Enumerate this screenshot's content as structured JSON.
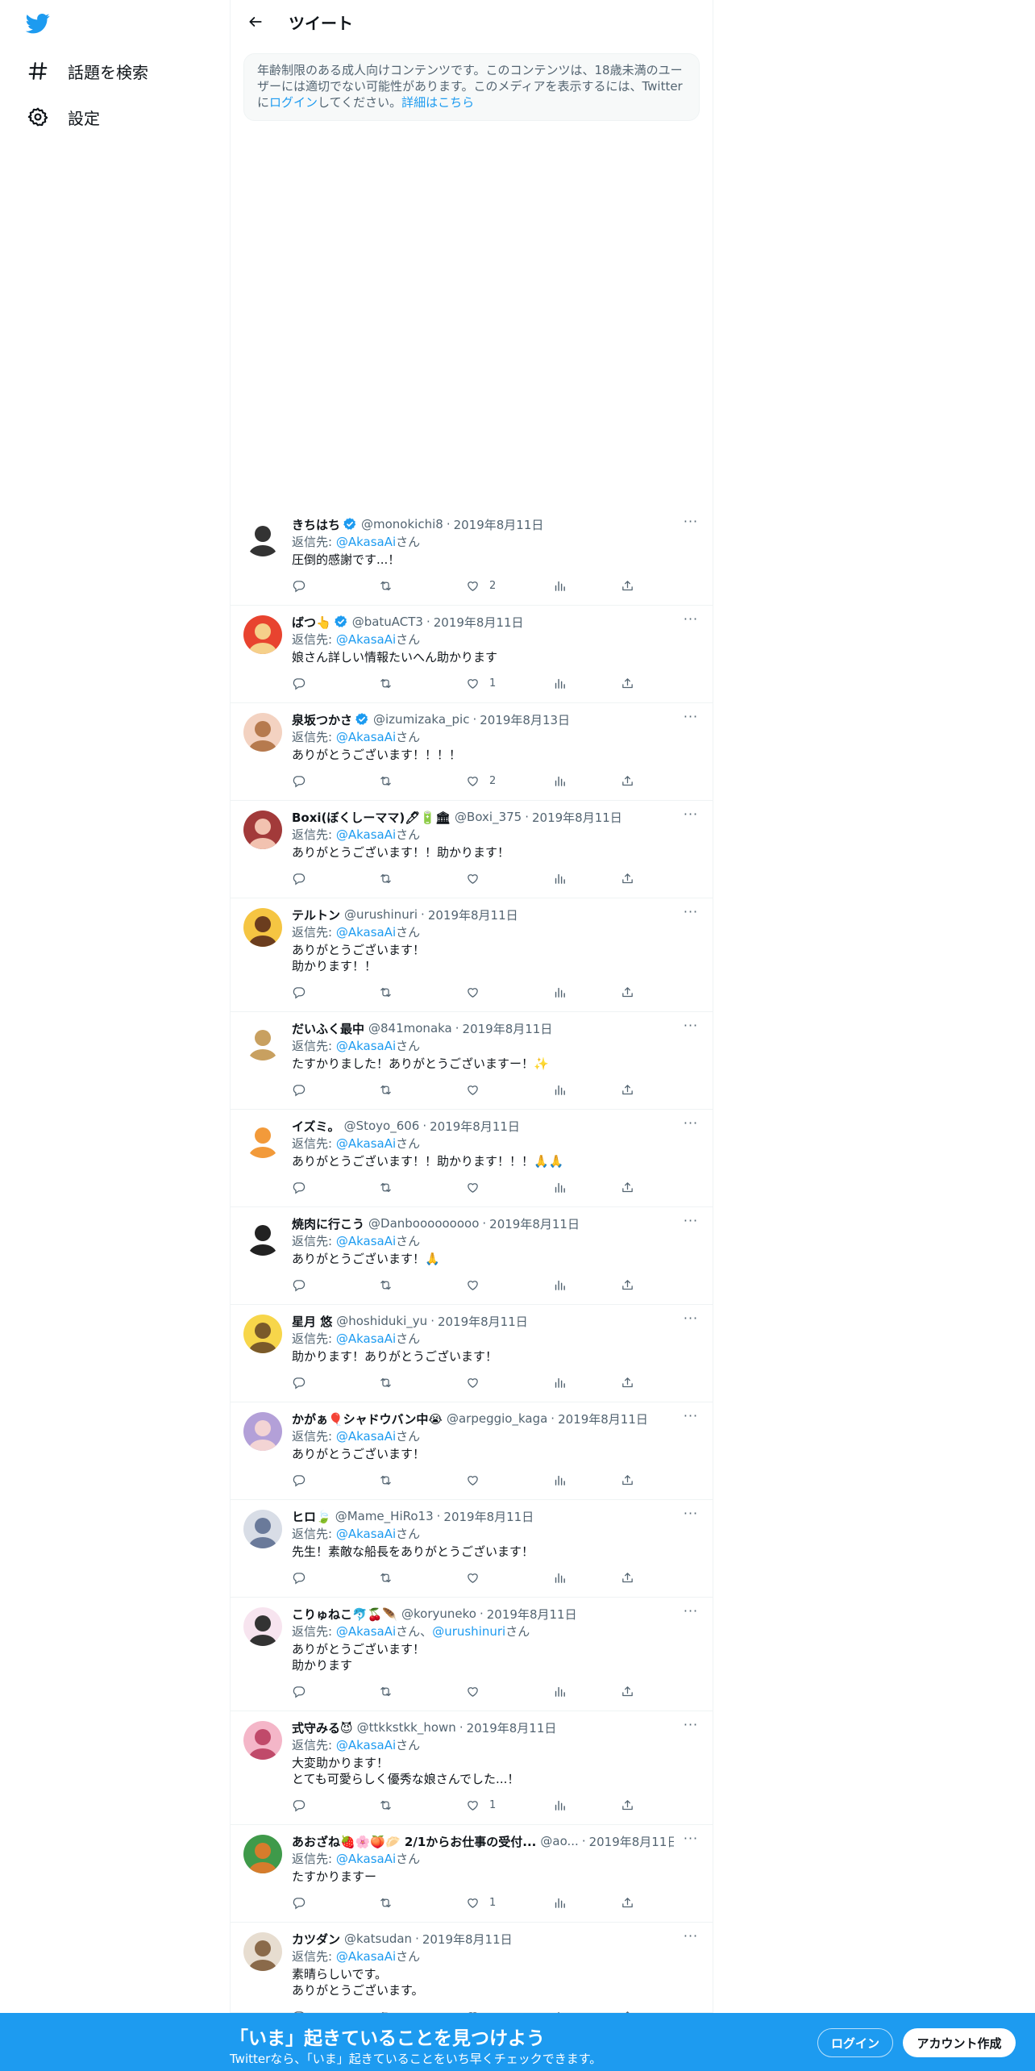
{
  "colors": {
    "brand": "#1d9bf0",
    "text": "#0f1419",
    "muted": "#536471",
    "border": "#eff3f4"
  },
  "sidebar": {
    "logo_icon": "twitter-bird-icon",
    "items": [
      {
        "label": "話題を検索",
        "icon": "hashtag-icon"
      },
      {
        "label": "設定",
        "icon": "gear-icon"
      }
    ]
  },
  "header": {
    "title": "ツイート",
    "back_icon": "arrow-left-icon"
  },
  "notice": {
    "text_before": "年齢制限のある成人向けコンテンツです。このコンテンツは、18歳未満のユーザーには適切でない可能性があります。このメディアを表示するには、Twitter",
    "text_mid": "に",
    "login_link": "ログイン",
    "text_after": "してください。",
    "details_link": "詳細はこちら"
  },
  "reply_label": "返信先:",
  "honorific": "さん",
  "reply_comma": "、",
  "replies": [
    {
      "name": "きちはち",
      "verified": true,
      "handle": "@monokichi8",
      "date": "2019年8月11日",
      "to": [
        "@AkasaAi"
      ],
      "lines": [
        "圧倒的感謝です...！"
      ],
      "likes": "2"
    },
    {
      "name": "ばつ👆",
      "verified": true,
      "handle": "@batuACT3",
      "date": "2019年8月11日",
      "to": [
        "@AkasaAi"
      ],
      "lines": [
        "娘さん詳しい情報たいへん助かります"
      ],
      "likes": "1"
    },
    {
      "name": "泉坂つかさ",
      "verified": true,
      "handle": "@izumizaka_pic",
      "date": "2019年8月13日",
      "to": [
        "@AkasaAi"
      ],
      "lines": [
        "ありがとうございます！！！！"
      ],
      "likes": "2"
    },
    {
      "name": "Boxi(ぼくしーママ)🖊🔋🏛",
      "verified": false,
      "handle": "@Boxi_375",
      "date": "2019年8月11日",
      "to": [
        "@AkasaAi"
      ],
      "lines": [
        "ありがとうございます！！助かります！"
      ],
      "likes": ""
    },
    {
      "name": "テルトン",
      "verified": false,
      "handle": "@urushinuri",
      "date": "2019年8月11日",
      "to": [
        "@AkasaAi"
      ],
      "lines": [
        "ありがとうございます！",
        "助かります！！"
      ],
      "likes": ""
    },
    {
      "name": "だいふく最中",
      "verified": false,
      "handle": "@841monaka",
      "date": "2019年8月11日",
      "to": [
        "@AkasaAi"
      ],
      "lines": [
        "たすかりました！ありがとうございますー！✨"
      ],
      "likes": ""
    },
    {
      "name": "イズミ。",
      "verified": false,
      "handle": "@Stoyo_606",
      "date": "2019年8月11日",
      "to": [
        "@AkasaAi"
      ],
      "lines": [
        "ありがとうございます！！助かります！！！🙏🙏"
      ],
      "likes": ""
    },
    {
      "name": "焼肉に行こう",
      "verified": false,
      "handle": "@Danbooooooooo",
      "date": "2019年8月11日",
      "to": [
        "@AkasaAi"
      ],
      "lines": [
        "ありがとうございます！🙏"
      ],
      "likes": ""
    },
    {
      "name": "星月 悠",
      "verified": false,
      "handle": "@hoshiduki_yu",
      "date": "2019年8月11日",
      "to": [
        "@AkasaAi"
      ],
      "lines": [
        "助かります！ありがとうございます！"
      ],
      "likes": ""
    },
    {
      "name": "かがぁ🎈シャドウバン中😭",
      "verified": false,
      "handle": "@arpeggio_kaga",
      "date": "2019年8月11日",
      "to": [
        "@AkasaAi"
      ],
      "lines": [
        "ありがとうございます！"
      ],
      "likes": ""
    },
    {
      "name": "ヒロ🍃",
      "verified": false,
      "handle": "@Mame_HiRo13",
      "date": "2019年8月11日",
      "to": [
        "@AkasaAi"
      ],
      "lines": [
        "先生！素敵な船長をありがとうございます！"
      ],
      "likes": ""
    },
    {
      "name": "こりゅねこ🐬🍒🪶",
      "verified": false,
      "handle": "@koryuneko",
      "date": "2019年8月11日",
      "to": [
        "@AkasaAi",
        "@urushinuri"
      ],
      "lines": [
        "ありがとうございます！",
        "助かります"
      ],
      "likes": ""
    },
    {
      "name": "式守みる😈",
      "verified": false,
      "handle": "@ttkkstkk_hown",
      "date": "2019年8月11日",
      "to": [
        "@AkasaAi"
      ],
      "lines": [
        "大変助かります！",
        "とても可愛らしく優秀な娘さんでした...！"
      ],
      "likes": "1"
    },
    {
      "name": "あおざね🍓🌸🍑🥟 2/1からお仕事の受付...",
      "verified": false,
      "handle": "@ao...",
      "date": "2019年8月11日",
      "to": [
        "@AkasaAi"
      ],
      "lines": [
        "たすかりますー"
      ],
      "likes": "1"
    },
    {
      "name": "カツダン",
      "verified": false,
      "handle": "@katsudan",
      "date": "2019年8月11日",
      "to": [
        "@AkasaAi"
      ],
      "lines": [
        "素晴らしいです。",
        "ありがとうございます。"
      ],
      "likes": ""
    }
  ],
  "banner": {
    "title": "「いま」起きていることを見つけよう",
    "subtitle": "Twitterなら、「いま」起きていることをいち早くチェックできます。",
    "login": "ログイン",
    "signup": "アカウント作成"
  }
}
